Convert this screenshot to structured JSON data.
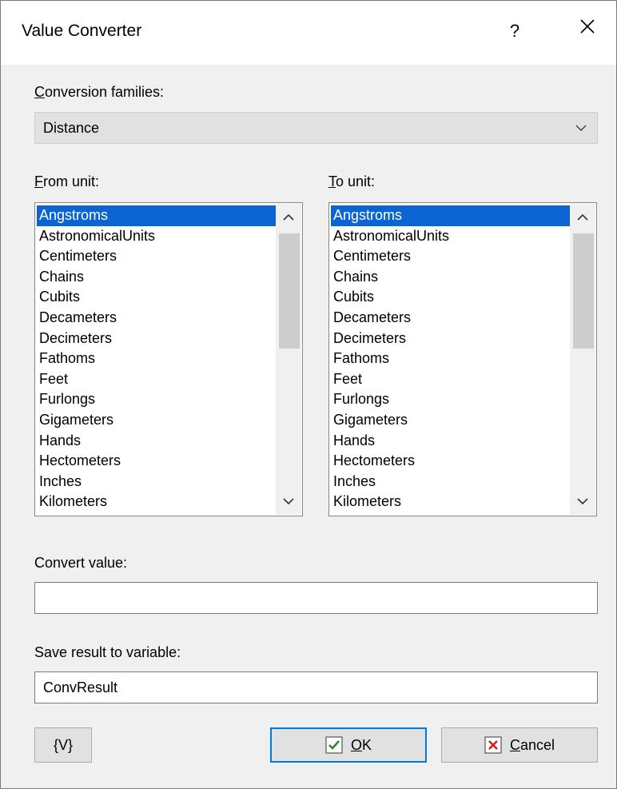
{
  "window": {
    "title": "Value Converter",
    "help_label": "?"
  },
  "conversion_families": {
    "label_key": "C",
    "label_rest": "onversion families:",
    "selected": "Distance"
  },
  "from_unit": {
    "label_key": "F",
    "label_rest": "rom unit:",
    "items": [
      "Angstroms",
      "AstronomicalUnits",
      "Centimeters",
      "Chains",
      "Cubits",
      "Decameters",
      "Decimeters",
      "Fathoms",
      "Feet",
      "Furlongs",
      "Gigameters",
      "Hands",
      "Hectometers",
      "Inches",
      "Kilometers"
    ],
    "selected": "Angstroms"
  },
  "to_unit": {
    "label_key": "T",
    "label_rest": "o unit:",
    "items": [
      "Angstroms",
      "AstronomicalUnits",
      "Centimeters",
      "Chains",
      "Cubits",
      "Decameters",
      "Decimeters",
      "Fathoms",
      "Feet",
      "Furlongs",
      "Gigameters",
      "Hands",
      "Hectometers",
      "Inches",
      "Kilometers"
    ],
    "selected": "Angstroms"
  },
  "convert_value": {
    "label": "Convert value:",
    "value": ""
  },
  "save_result": {
    "label": "Save result to variable:",
    "value": "ConvResult"
  },
  "buttons": {
    "variables": "{V}",
    "ok_key": "O",
    "ok_rest": "K",
    "cancel_key": "C",
    "cancel_rest": "ancel"
  },
  "colors": {
    "selection": "#0a64d2",
    "default_button_border": "#0078d7",
    "ok_check": "#2a8a2a",
    "cancel_x": "#d02020"
  }
}
